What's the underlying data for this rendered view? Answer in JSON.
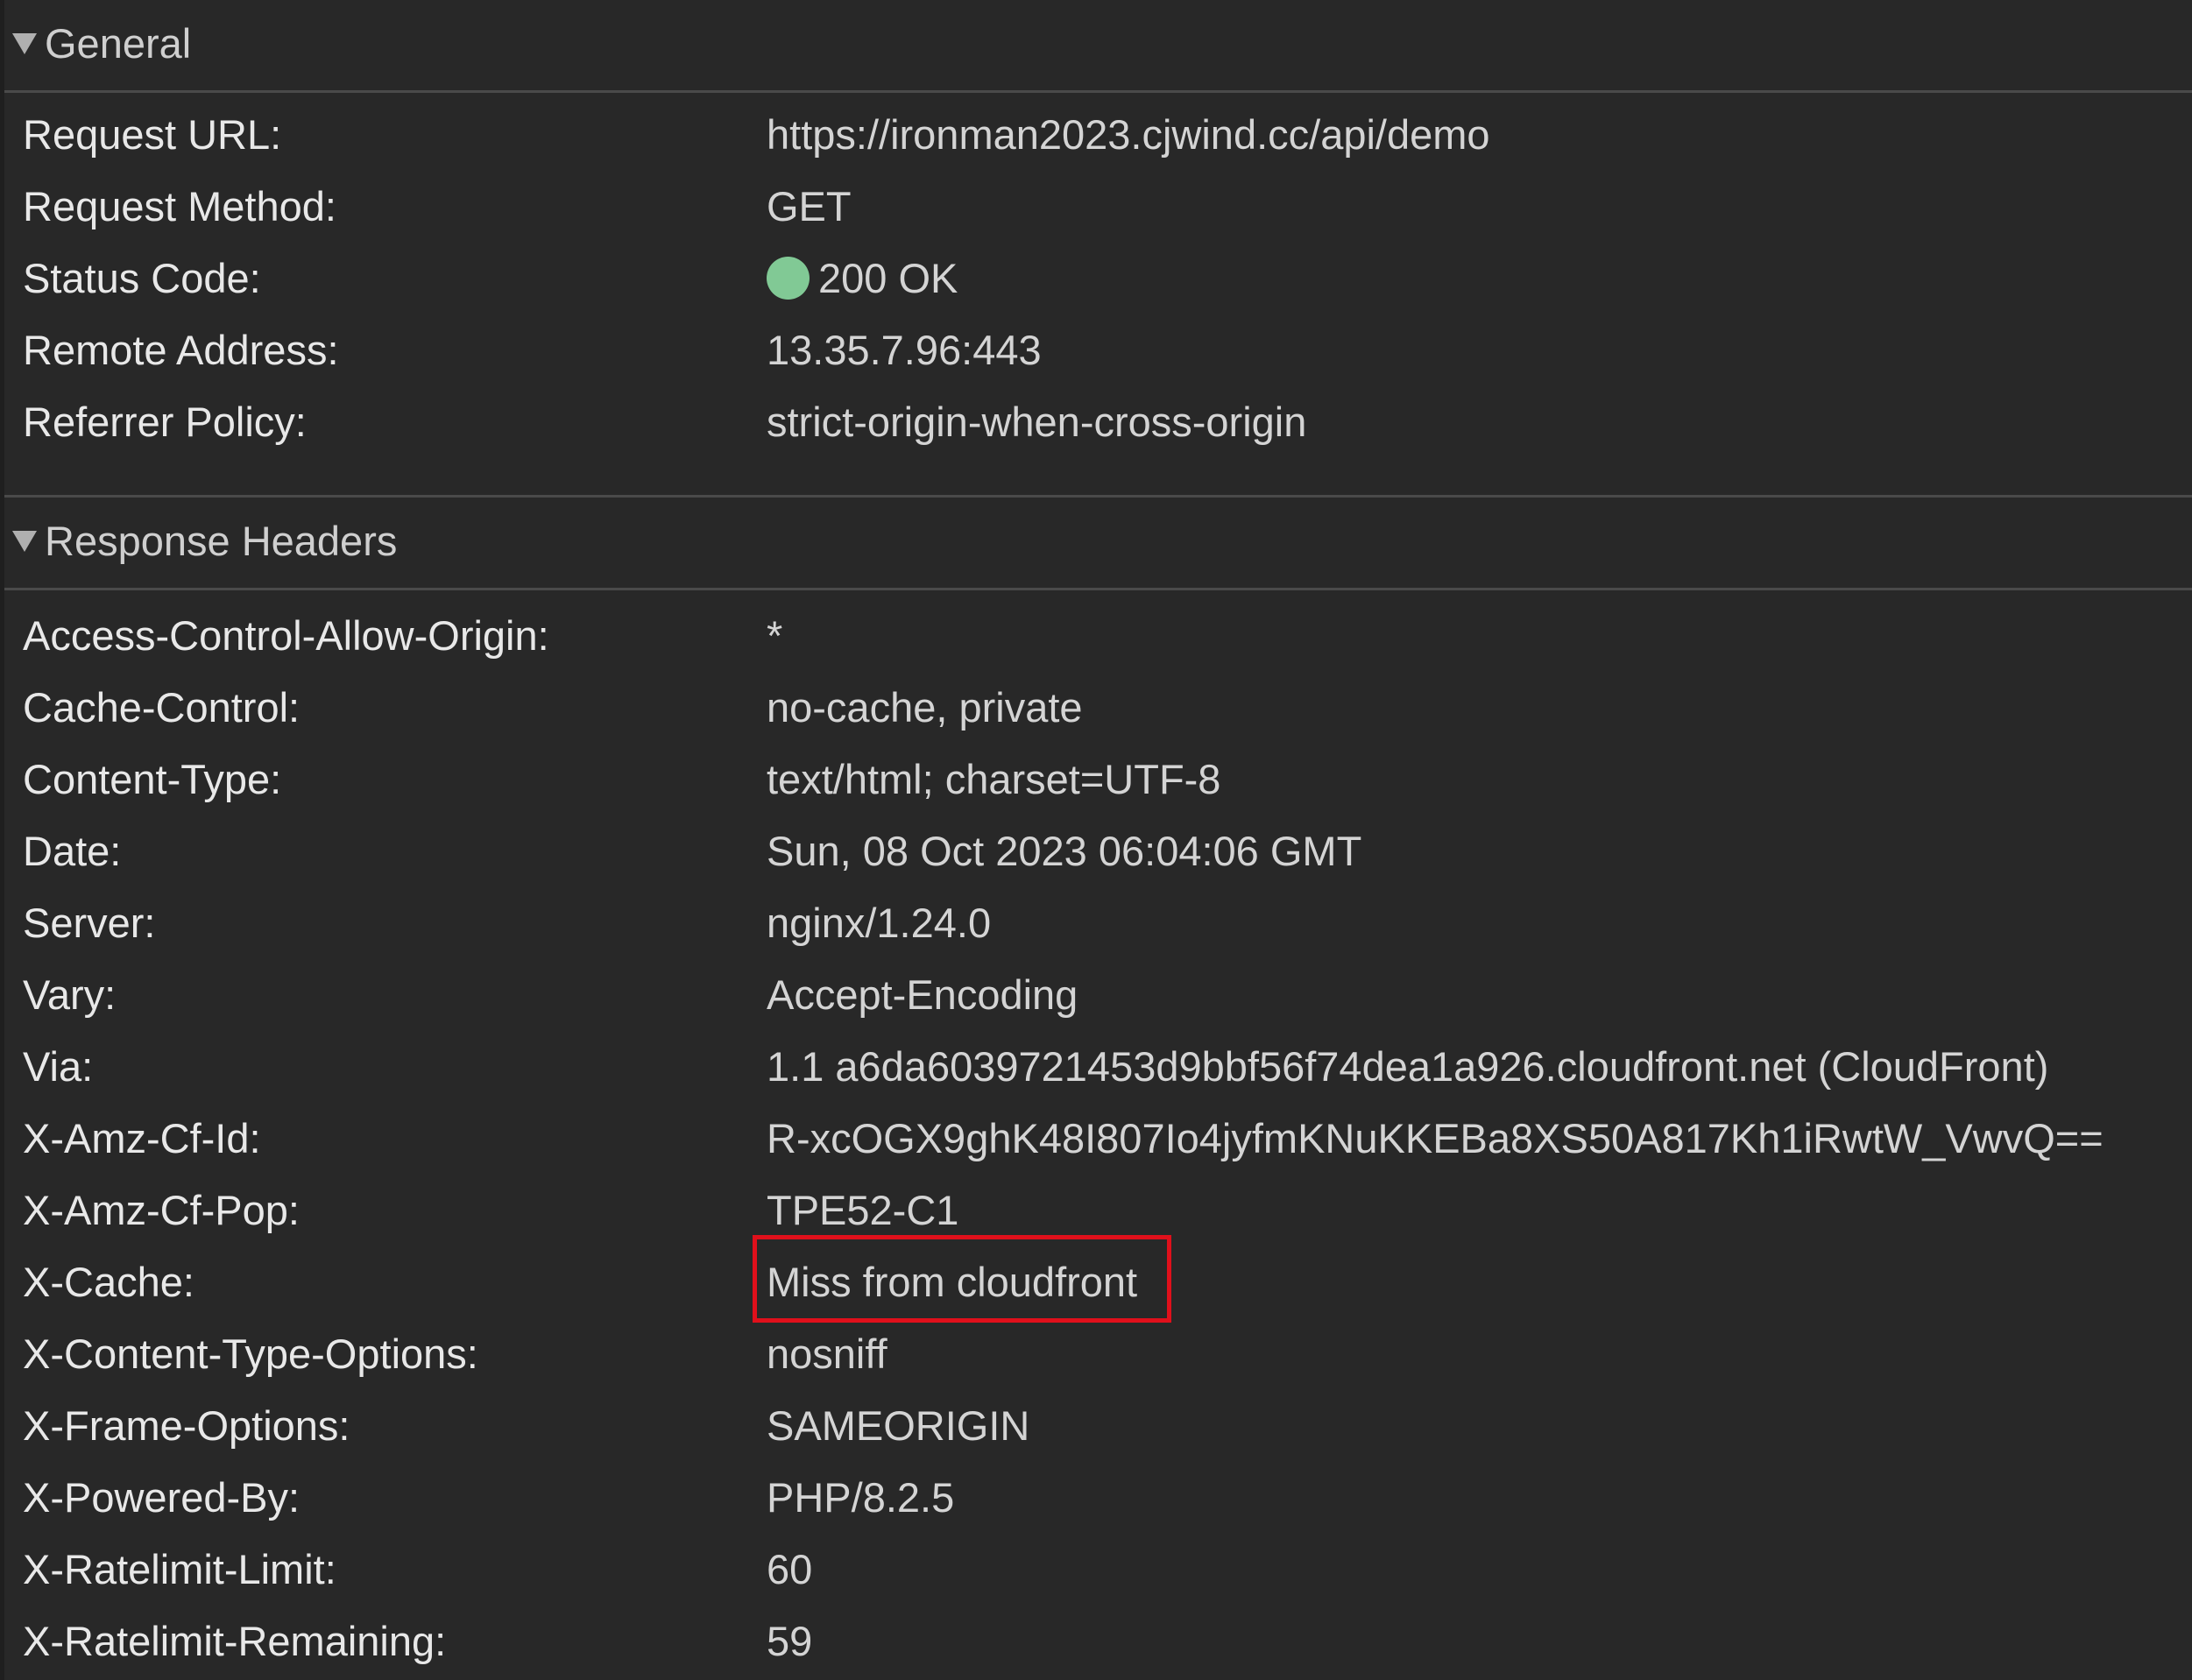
{
  "general": {
    "title": "General",
    "rows": [
      {
        "key": "Request URL:",
        "value": "https://ironman2023.cjwind.cc/api/demo"
      },
      {
        "key": "Request Method:",
        "value": "GET"
      },
      {
        "key": "Status Code:",
        "value": "200 OK",
        "status_color": "#81c995"
      },
      {
        "key": "Remote Address:",
        "value": "13.35.7.96:443"
      },
      {
        "key": "Referrer Policy:",
        "value": "strict-origin-when-cross-origin"
      }
    ]
  },
  "response_headers": {
    "title": "Response Headers",
    "rows": [
      {
        "key": "Access-Control-Allow-Origin:",
        "value": "*"
      },
      {
        "key": "Cache-Control:",
        "value": "no-cache, private"
      },
      {
        "key": "Content-Type:",
        "value": "text/html; charset=UTF-8"
      },
      {
        "key": "Date:",
        "value": "Sun, 08 Oct 2023 06:04:06 GMT"
      },
      {
        "key": "Server:",
        "value": "nginx/1.24.0"
      },
      {
        "key": "Vary:",
        "value": "Accept-Encoding"
      },
      {
        "key": "Via:",
        "value": "1.1 a6da6039721453d9bbf56f74dea1a926.cloudfront.net (CloudFront)"
      },
      {
        "key": "X-Amz-Cf-Id:",
        "value": "R-xcOGX9ghK48I807Io4jyfmKNuKKEBa8XS50A817Kh1iRwtW_VwvQ=="
      },
      {
        "key": "X-Amz-Cf-Pop:",
        "value": "TPE52-C1"
      },
      {
        "key": "X-Cache:",
        "value": "Miss from cloudfront",
        "highlight_color": "#e0101b"
      },
      {
        "key": "X-Content-Type-Options:",
        "value": "nosniff"
      },
      {
        "key": "X-Frame-Options:",
        "value": "SAMEORIGIN"
      },
      {
        "key": "X-Powered-By:",
        "value": "PHP/8.2.5"
      },
      {
        "key": "X-Ratelimit-Limit:",
        "value": "60"
      },
      {
        "key": "X-Ratelimit-Remaining:",
        "value": "59"
      }
    ]
  }
}
